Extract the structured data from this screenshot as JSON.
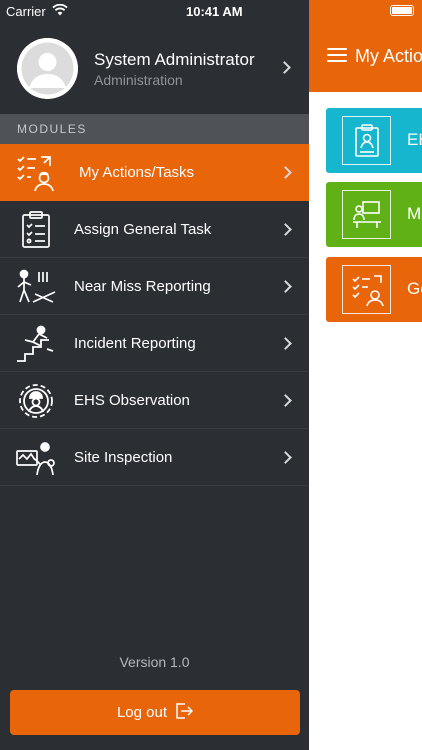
{
  "status_bar": {
    "carrier": "Carrier",
    "time": "10:41 AM"
  },
  "profile": {
    "name": "System Administrator",
    "role": "Administration"
  },
  "modules_header": "MODULES",
  "menu": [
    {
      "label": "My Actions/Tasks",
      "icon": "tasks-checklist-icon",
      "active": true
    },
    {
      "label": "Assign General Task",
      "icon": "clipboard-checklist-icon",
      "active": false
    },
    {
      "label": "Near Miss Reporting",
      "icon": "near-miss-icon",
      "active": false
    },
    {
      "label": "Incident Reporting",
      "icon": "fall-stairs-icon",
      "active": false
    },
    {
      "label": "EHS Observation",
      "icon": "worker-gear-icon",
      "active": false
    },
    {
      "label": "Site Inspection",
      "icon": "site-inspection-icon",
      "active": false
    }
  ],
  "version": "Version 1.0",
  "logout": {
    "label": "Log out",
    "icon": "logout-icon"
  },
  "main": {
    "title": "My Actio",
    "tiles": [
      {
        "label": "EH",
        "color": "#16b6cf",
        "icon": "clipboard-worker-icon"
      },
      {
        "label": "M",
        "color": "#5fb115",
        "icon": "meeting-presentation-icon"
      },
      {
        "label": "Ge",
        "color": "#e8650a",
        "icon": "tasks-checklist-icon"
      }
    ]
  },
  "colors": {
    "accent": "#e8650a",
    "drawer_bg": "#2b2e33",
    "section_bg": "#4f5358"
  }
}
